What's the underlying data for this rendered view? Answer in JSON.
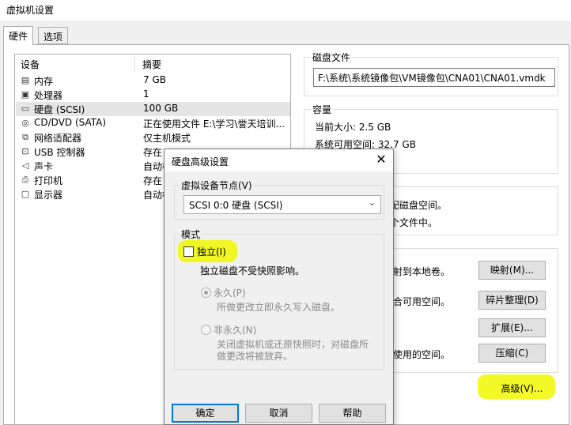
{
  "window": {
    "title": "虚拟机设置"
  },
  "tabs": [
    {
      "label": "硬件"
    },
    {
      "label": "选项"
    }
  ],
  "devices": {
    "headers": {
      "device": "设备",
      "summary": "摘要"
    },
    "rows": [
      {
        "icon": "memory-icon",
        "name": "内存",
        "summary": "7 GB"
      },
      {
        "icon": "processor-icon",
        "name": "处理器",
        "summary": "1"
      },
      {
        "icon": "hard-disk-icon",
        "name": "硬盘 (SCSI)",
        "summary": "100 GB"
      },
      {
        "icon": "cd-dvd-icon",
        "name": "CD/DVD (SATA)",
        "summary": "正在使用文件 E:\\学习\\誉天培训..."
      },
      {
        "icon": "network-adapter-icon",
        "name": "网络适配器",
        "summary": "仅主机模式"
      },
      {
        "icon": "usb-icon",
        "name": "USB 控制器",
        "summary": "存在"
      },
      {
        "icon": "sound-card-icon",
        "name": "声卡",
        "summary": "自动检"
      },
      {
        "icon": "printer-icon",
        "name": "打印机",
        "summary": "存在"
      },
      {
        "icon": "display-icon",
        "name": "显示器",
        "summary": "自动检"
      }
    ]
  },
  "disk_file": {
    "label": "磁盘文件",
    "path": "F:\\系统\\系统镜像包\\VM镜像包\\CNA01\\CNA01.vmdk"
  },
  "capacity": {
    "label": "容量",
    "current_size": "当前大小: 2.5 GB",
    "free_space": "系统可用空间: 32.7 GB"
  },
  "partial_texts": {
    "alloc1": "配磁盘空间。",
    "alloc2": "个文件中。",
    "util1": "射到本地卷。",
    "util2": "合可用空间。",
    "util3": "使用的空间。"
  },
  "buttons": {
    "map": "映射(M)...",
    "defrag": "碎片整理(D)",
    "expand": "扩展(E)...",
    "compact": "压缩(C)",
    "advanced": "高级(V)..."
  },
  "dialog": {
    "title": "硬盘高级设置",
    "close": "✕",
    "node_group": "虚拟设备节点(V)",
    "node_select": "SCSI 0:0   硬盘 (SCSI)",
    "mode_group": "模式",
    "independent": "独立(I)",
    "independent_desc": "独立磁盘不受快照影响。",
    "persistent": "永久(P)",
    "persistent_desc": "所做更改立即永久写入磁盘。",
    "nonpersistent": "非永久(N)",
    "nonpersistent_desc1": "关闭虚拟机或还原快照时，对磁盘所",
    "nonpersistent_desc2": "做更改将被放弃。",
    "ok": "确定",
    "cancel": "取消",
    "help": "帮助"
  },
  "colors": {
    "highlight": "#f0f800",
    "selection": "#e5e5e5",
    "accent": "#0078d7"
  }
}
